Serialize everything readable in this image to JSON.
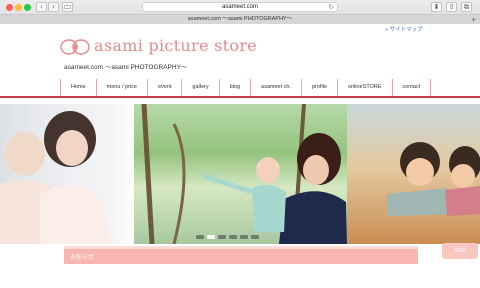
{
  "browser": {
    "url": "asameet.com",
    "tab_title": "asameet.com 〜asami PHOTOGRAPHY〜"
  },
  "site": {
    "sitemap_link": "» サイトマップ",
    "logo_text": "asami picture store",
    "tagline": "asameet.com 〜asami PHOTOGRAPHY〜"
  },
  "nav": {
    "items": [
      "Home",
      "menu / price",
      "event",
      "gallery",
      "blog",
      "asameet ch.",
      "profile",
      "onlineSTORE",
      "contact"
    ]
  },
  "hero": {
    "slide_count": 6,
    "active_slide": 1
  },
  "info": {
    "label": "お知らせ"
  },
  "top_button": {
    "label": "TOP"
  },
  "colors": {
    "accent": "#c73b4a",
    "logo": "#e48a8a",
    "info_bar": "#f7b7b0"
  }
}
